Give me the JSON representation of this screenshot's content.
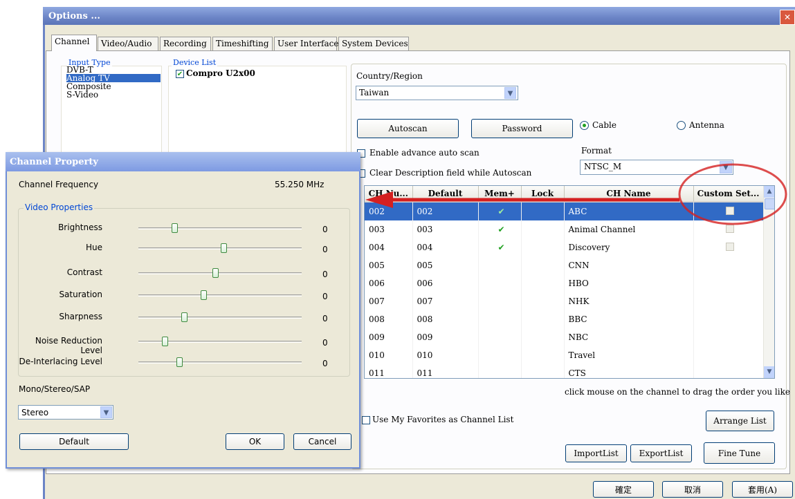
{
  "options": {
    "title": "Options ...",
    "close_glyph": "✕",
    "tabs": [
      "Channel",
      "Video/Audio",
      "Recording",
      "Timeshifting",
      "User Interface",
      "System Devices"
    ],
    "input_type": {
      "legend": "Input Type",
      "items": [
        "DVB-T",
        "Analog TV",
        "Composite",
        "S-Video"
      ],
      "selected": "Analog TV"
    },
    "device_list": {
      "legend": "Device List",
      "device": "Compro U2x00"
    },
    "country": {
      "label": "Country/Region",
      "value": "Taiwan"
    },
    "buttons": {
      "autoscan": "Autoscan",
      "password": "Password",
      "arrange": "Arrange List",
      "import": "ImportList",
      "export": "ExportList",
      "finetune": "Fine Tune",
      "ok": "確定",
      "cancel": "取消",
      "apply": "套用(A)"
    },
    "radio": {
      "cable": "Cable",
      "antenna": "Antenna",
      "selected": "Cable"
    },
    "checks": {
      "advance": "Enable advance auto scan",
      "clear_desc": "Clear Description field while Autoscan",
      "favorites": "Use My Favorites as Channel List"
    },
    "format": {
      "label": "Format",
      "value": "NTSC_M"
    },
    "table": {
      "headers": [
        "CH Nu...",
        "Default",
        "Mem+",
        "Lock",
        "CH Name",
        "Custom Set..."
      ],
      "rows": [
        {
          "ch": "002",
          "def": "002",
          "mem": true,
          "name": "ABC",
          "custom": true
        },
        {
          "ch": "003",
          "def": "003",
          "mem": true,
          "name": "Animal Channel",
          "custom": true
        },
        {
          "ch": "004",
          "def": "004",
          "mem": true,
          "name": "Discovery",
          "custom": true
        },
        {
          "ch": "005",
          "def": "005",
          "mem": false,
          "name": "CNN",
          "custom": false
        },
        {
          "ch": "006",
          "def": "006",
          "mem": false,
          "name": "HBO",
          "custom": false
        },
        {
          "ch": "007",
          "def": "007",
          "mem": false,
          "name": "NHK",
          "custom": false
        },
        {
          "ch": "008",
          "def": "008",
          "mem": false,
          "name": "BBC",
          "custom": false
        },
        {
          "ch": "009",
          "def": "009",
          "mem": false,
          "name": "NBC",
          "custom": false
        },
        {
          "ch": "010",
          "def": "010",
          "mem": false,
          "name": "Travel",
          "custom": false
        },
        {
          "ch": "011",
          "def": "011",
          "mem": false,
          "name": "CTS",
          "custom": false
        }
      ],
      "selected_row": 0
    },
    "hint": "click mouse on the channel to drag the order you like",
    "check_glyph": "✔"
  },
  "channel_property": {
    "title": "Channel Property",
    "freq_label": "Channel Frequency",
    "freq_value": "55.250 MHz",
    "video_legend": "Video Properties",
    "sliders": [
      {
        "label": "Brightness",
        "value": "0",
        "level": 0.22
      },
      {
        "label": "Hue",
        "value": "0",
        "level": 0.52
      },
      {
        "label": "Contrast",
        "value": "0",
        "level": 0.47
      },
      {
        "label": "Saturation",
        "value": "0",
        "level": 0.4
      },
      {
        "label": "Sharpness",
        "value": "0",
        "level": 0.28
      },
      {
        "label": "Noise Reduction Level",
        "value": "0",
        "level": 0.16
      },
      {
        "label": "De-Interlacing Level",
        "value": "0",
        "level": 0.25
      }
    ],
    "audio_label": "Mono/Stereo/SAP",
    "audio_value": "Stereo",
    "default_label": "Default",
    "ok_label": "OK",
    "cancel_label": "Cancel"
  },
  "colors": {
    "selection": "#316ac5",
    "annotation": "#d42020",
    "titlebar": "#6b84c6"
  }
}
